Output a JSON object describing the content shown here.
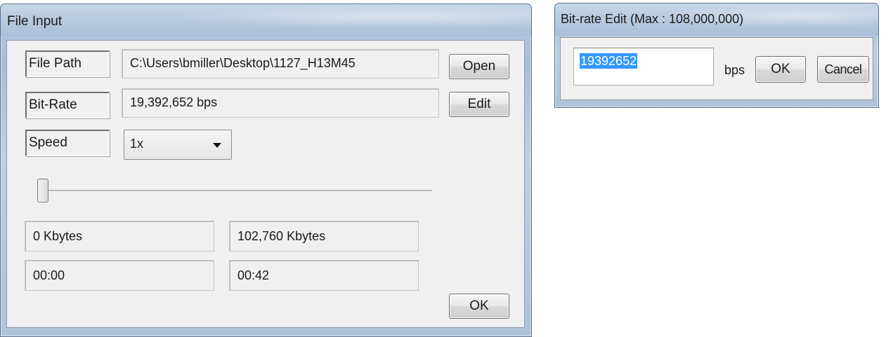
{
  "file_input": {
    "title": "File Input",
    "file_path": {
      "label": "File Path",
      "value": "C:\\Users\\bmiller\\Desktop\\1127_H13M45",
      "button": "Open"
    },
    "bit_rate": {
      "label": "Bit-Rate",
      "value": "19,392,652 bps",
      "button": "Edit"
    },
    "speed": {
      "label": "Speed",
      "selected": "1x"
    },
    "slider": {
      "position_fraction": 0.0
    },
    "size_start": "0 Kbytes",
    "size_end": "102,760 Kbytes",
    "time_start": "00:00",
    "time_end": "00:42",
    "ok_button": "OK"
  },
  "bitrate_edit": {
    "title": "Bit-rate Edit (Max : 108,000,000)",
    "input_value": "19392652",
    "unit": "bps",
    "ok_button": "OK",
    "cancel_button": "Cancel"
  },
  "icons": [
    "dropdown-arrow-icon"
  ]
}
